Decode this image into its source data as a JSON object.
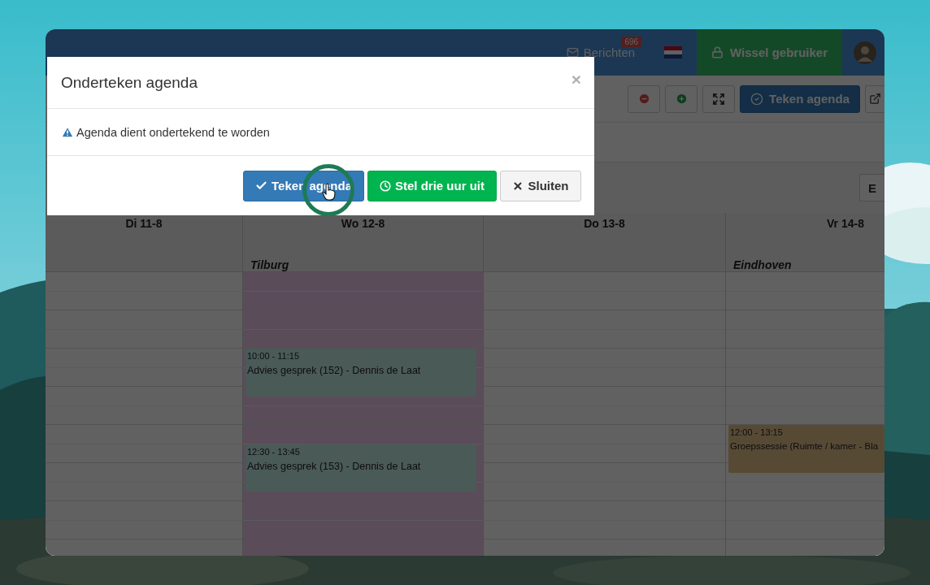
{
  "navbar": {
    "messages": {
      "label": "Berichten",
      "badge": "696"
    },
    "switch_user": {
      "label": "Wissel gebruiker"
    }
  },
  "toolbar": {
    "buttons": [
      {
        "kind": "remove"
      },
      {
        "kind": "add"
      },
      {
        "kind": "fullscreen"
      },
      {
        "kind": "sign",
        "label": "Teken agenda"
      },
      {
        "kind": "export"
      }
    ]
  },
  "filter_row": {
    "edge_button": "E"
  },
  "calendar": {
    "days": [
      {
        "label": "Di 11-8",
        "highlighted": false
      },
      {
        "label": "Wo 12-8",
        "location": "Tilburg",
        "highlighted": true,
        "events": [
          {
            "time": "10:00 - 11:15",
            "title": "Advies gesprek (152) - Dennis de Laat",
            "color": "#4a5a57"
          },
          {
            "time": "12:30 - 13:45",
            "title": "Advies gesprek (153) - Dennis de Laat",
            "color": "#4a5a57"
          }
        ]
      },
      {
        "label": "Do 13-8",
        "highlighted": false
      },
      {
        "label": "Vr 14-8",
        "location": "Eindhoven",
        "highlighted": false,
        "events": [
          {
            "time": "12:00 - 13:15",
            "title": "Groepssessie (Ruimte / kamer - Bla",
            "color": "#574a35"
          }
        ]
      }
    ]
  },
  "modal": {
    "title": "Onderteken agenda",
    "close": "×",
    "message": "Agenda dient ondertekend te worden",
    "buttons": [
      {
        "label": "Teken agenda",
        "kind": "primary"
      },
      {
        "label": "Stel drie uur uit",
        "kind": "success"
      },
      {
        "label": "Sluiten",
        "kind": "default"
      }
    ]
  }
}
